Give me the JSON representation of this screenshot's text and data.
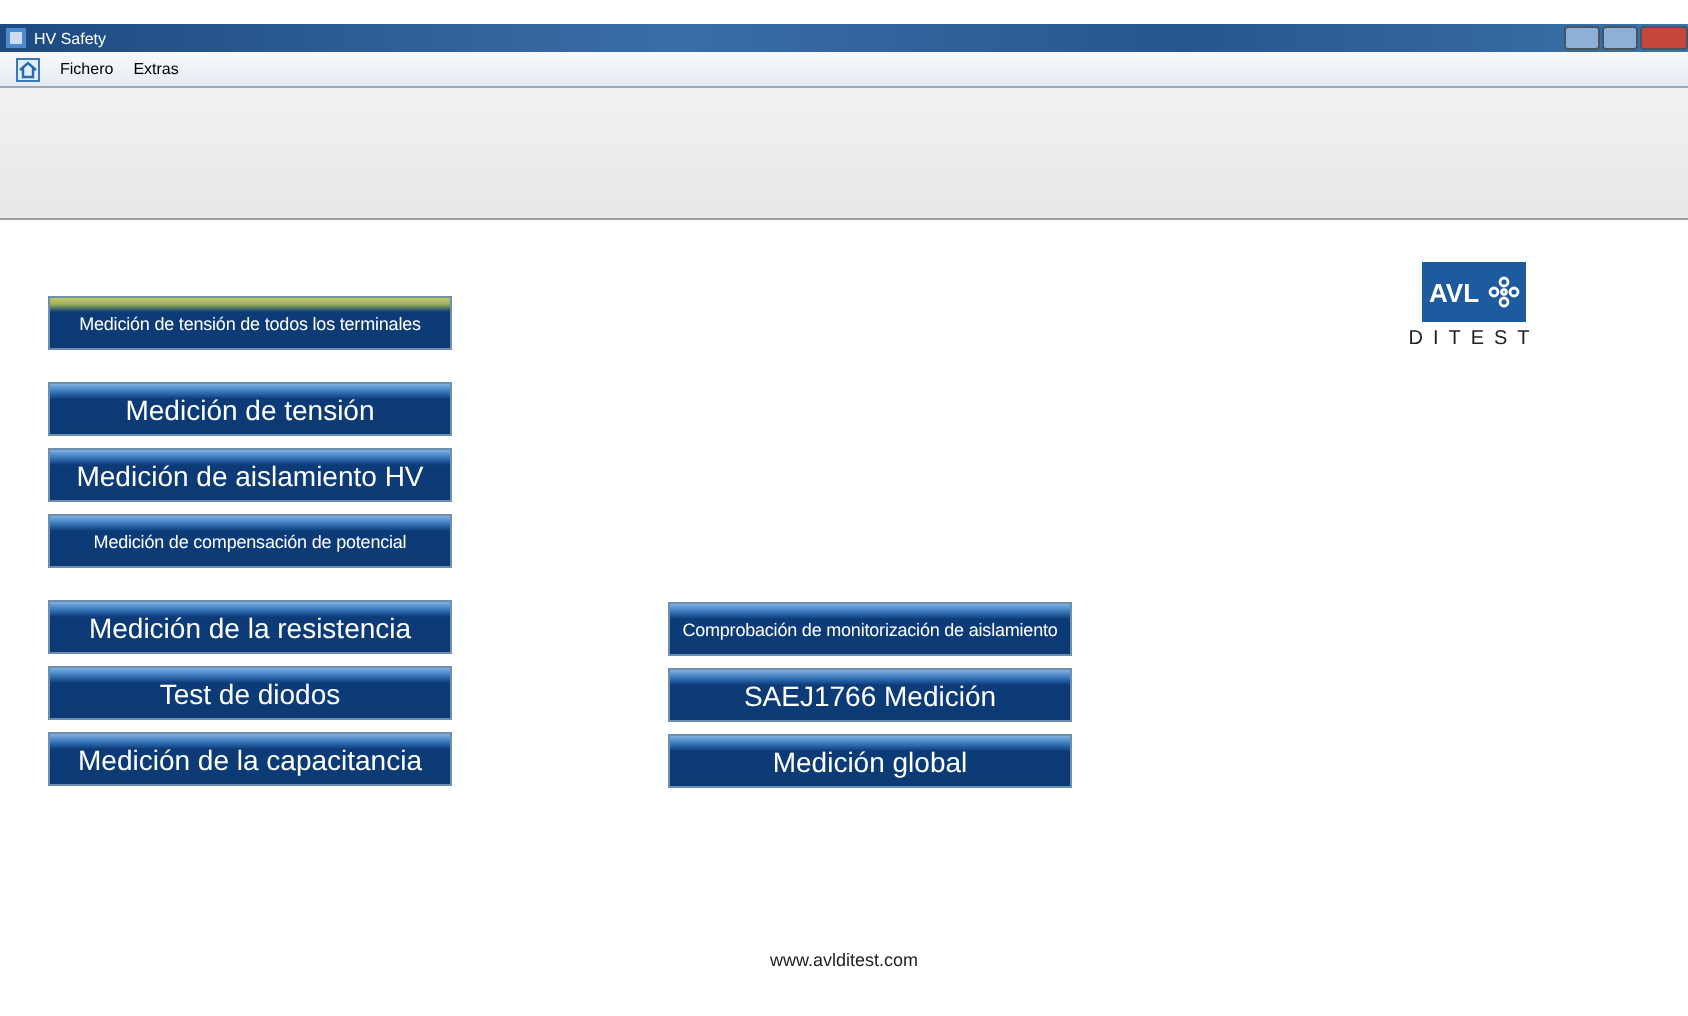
{
  "window": {
    "title": "HV Safety"
  },
  "menu": [
    "Fichero",
    "Extras"
  ],
  "logo": {
    "brand": "AVL",
    "subtitle": "DITEST"
  },
  "left_buttons": [
    {
      "label": "Medición de tensión de todos los terminales",
      "kind": "compact",
      "selected": true
    },
    {
      "label": "Medición de tensión",
      "kind": "standard",
      "selected": false
    },
    {
      "label": "Medición de aislamiento HV",
      "kind": "standard",
      "selected": false
    },
    {
      "label": "Medición de compensación de potencial",
      "kind": "compact",
      "selected": false
    },
    {
      "label": "Medición de la resistencia",
      "kind": "standard",
      "selected": false
    },
    {
      "label": "Test de diodos",
      "kind": "standard",
      "selected": false
    },
    {
      "label": "Medición de la capacitancia",
      "kind": "standard",
      "selected": false
    }
  ],
  "right_buttons": [
    {
      "label": "Comprobación de monitorización de aislamiento",
      "kind": "compact",
      "selected": false
    },
    {
      "label": "SAEJ1766 Medición",
      "kind": "standard",
      "selected": false
    },
    {
      "label": "Medición global",
      "kind": "standard",
      "selected": false
    }
  ],
  "footer": "www.avlditest.com"
}
